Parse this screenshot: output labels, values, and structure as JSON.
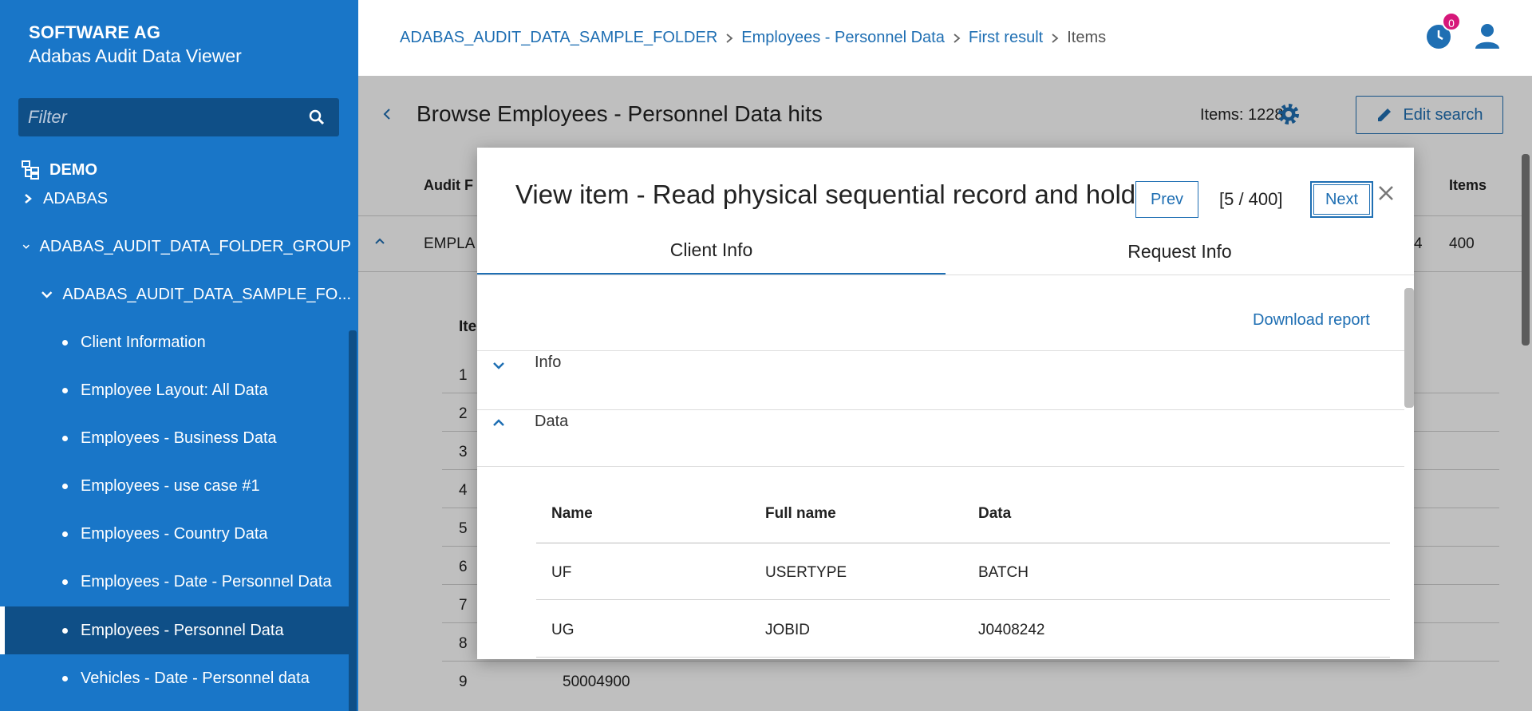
{
  "brand": {
    "company": "SOFTWARE AG",
    "app": "Adabas Audit Data Viewer"
  },
  "sidebar": {
    "filter_placeholder": "Filter",
    "root": "DEMO",
    "items": [
      {
        "label": "ADABAS",
        "level": 1,
        "state": "collapsed"
      },
      {
        "label": "ADABAS_AUDIT_DATA_FOLDER_GROUP",
        "level": 1,
        "state": "expanded"
      },
      {
        "label": "ADABAS_AUDIT_DATA_SAMPLE_FO...",
        "level": 2,
        "state": "expanded"
      },
      {
        "label": "Client Information",
        "level": 3
      },
      {
        "label": "Employee Layout: All Data",
        "level": 3
      },
      {
        "label": "Employees - Business Data",
        "level": 3
      },
      {
        "label": "Employees - use case #1",
        "level": 3
      },
      {
        "label": "Employees - Country Data",
        "level": 3
      },
      {
        "label": "Employees - Date - Personnel Data",
        "level": 3
      },
      {
        "label": "Employees - Personnel Data",
        "level": 3,
        "selected": true
      },
      {
        "label": "Vehicles - Date - Personnel data",
        "level": 3
      }
    ]
  },
  "breadcrumb": [
    "ADABAS_AUDIT_DATA_SAMPLE_FOLDER",
    "Employees - Personnel Data",
    "First result",
    "Items"
  ],
  "header": {
    "notification_count": "0"
  },
  "page": {
    "title": "Browse Employees - Personnel Data hits",
    "items_count": "Items: 1228",
    "edit_search": "Edit search",
    "col_audit": "Audit F",
    "col_items": "Items",
    "row_label": "EMPLA",
    "row_num": "4",
    "row_items": "400",
    "sub_header": "Ite",
    "row_numbers": [
      "1",
      "2",
      "3",
      "4",
      "5",
      "6",
      "7",
      "8",
      "9"
    ],
    "row9_value": "50004900"
  },
  "modal": {
    "title": "View item - Read physical sequential record and hold",
    "prev": "Prev",
    "counter": "[5 / 400]",
    "next": "Next",
    "tabs": [
      "Client Info",
      "Request Info"
    ],
    "download": "Download report",
    "sections": [
      "Info",
      "Data"
    ],
    "table": {
      "headers": [
        "Name",
        "Full name",
        "Data"
      ],
      "rows": [
        [
          "UF",
          "USERTYPE",
          "BATCH"
        ],
        [
          "UG",
          "JOBID",
          "J0408242"
        ]
      ]
    }
  },
  "colors": {
    "sidebar": "#1976c8",
    "sidebar_dark": "#0f4f87",
    "accent": "#1f6fb3",
    "badge": "#d6177a"
  }
}
